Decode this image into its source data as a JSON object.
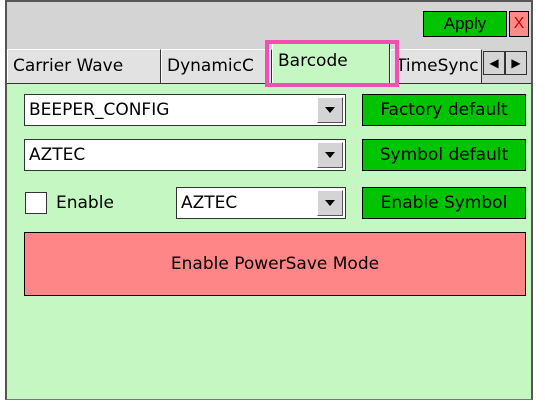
{
  "toolbar": {
    "apply_label": "Apply",
    "close_label": "X"
  },
  "tabs": [
    {
      "label": "Carrier Wave"
    },
    {
      "label": "DynamicC"
    },
    {
      "label": "Barcode",
      "active": true
    },
    {
      "label": "TimeSync"
    }
  ],
  "tab_nav": {
    "prev_icon": "arrow-left-icon",
    "next_icon": "arrow-right-icon"
  },
  "config_select": {
    "value": "BEEPER_CONFIG"
  },
  "symbol_select": {
    "value": "AZTEC"
  },
  "enable_checkbox": {
    "label": "Enable",
    "checked": false
  },
  "enable_symbol_select": {
    "value": "AZTEC"
  },
  "buttons": {
    "factory_default": "Factory default",
    "symbol_default": "Symbol default",
    "enable_symbol": "Enable Symbol",
    "powersave": "Enable PowerSave Mode"
  },
  "colors": {
    "panel_bg": "#c5f7c2",
    "green_button": "#00c400",
    "red_button": "#ff8686",
    "highlight": "#f050b0"
  }
}
